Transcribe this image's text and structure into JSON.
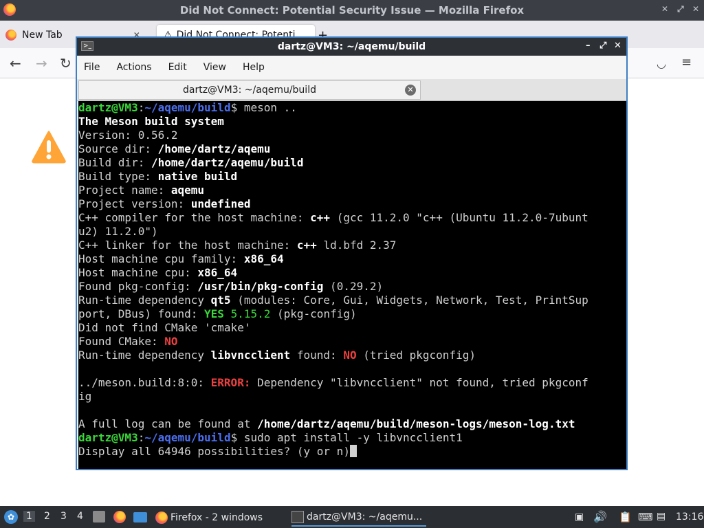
{
  "firefox": {
    "window_title": "Did Not Connect: Potential Security Issue — Mozilla Firefox",
    "tabs": [
      {
        "label": "New Tab"
      },
      {
        "label": "Did Not Connect: Potenti"
      }
    ],
    "new_tab_symbol": "+"
  },
  "terminal": {
    "window_title": "dartz@VM3: ~/aqemu/build",
    "menu": [
      "File",
      "Actions",
      "Edit",
      "View",
      "Help"
    ],
    "tab_label": "dartz@VM3: ~/aqemu/build",
    "lines": [
      [
        {
          "t": "dartz@VM3",
          "c": "g"
        },
        {
          "t": ":",
          "c": ""
        },
        {
          "t": "~/aqemu/build",
          "c": "b"
        },
        {
          "t": "$ meson ..",
          "c": ""
        }
      ],
      [
        {
          "t": "The Meson build system",
          "c": "w"
        }
      ],
      [
        {
          "t": "Version: 0.56.2",
          "c": ""
        }
      ],
      [
        {
          "t": "Source dir: ",
          "c": ""
        },
        {
          "t": "/home/dartz/aqemu",
          "c": "w"
        }
      ],
      [
        {
          "t": "Build dir: ",
          "c": ""
        },
        {
          "t": "/home/dartz/aqemu/build",
          "c": "w"
        }
      ],
      [
        {
          "t": "Build type: ",
          "c": ""
        },
        {
          "t": "native build",
          "c": "w"
        }
      ],
      [
        {
          "t": "Project name: ",
          "c": ""
        },
        {
          "t": "aqemu",
          "c": "w"
        }
      ],
      [
        {
          "t": "Project version: ",
          "c": ""
        },
        {
          "t": "undefined",
          "c": "w"
        }
      ],
      [
        {
          "t": "C++ compiler for the host machine: ",
          "c": ""
        },
        {
          "t": "c++",
          "c": "w"
        },
        {
          "t": " (gcc 11.2.0 \"c++ (Ubuntu 11.2.0-7ubunt",
          "c": ""
        }
      ],
      [
        {
          "t": "u2) 11.2.0\")",
          "c": ""
        }
      ],
      [
        {
          "t": "C++ linker for the host machine: ",
          "c": ""
        },
        {
          "t": "c++",
          "c": "w"
        },
        {
          "t": " ld.bfd 2.37",
          "c": ""
        }
      ],
      [
        {
          "t": "Host machine cpu family: ",
          "c": ""
        },
        {
          "t": "x86_64",
          "c": "w"
        }
      ],
      [
        {
          "t": "Host machine cpu: ",
          "c": ""
        },
        {
          "t": "x86_64",
          "c": "w"
        }
      ],
      [
        {
          "t": "Found pkg-config: ",
          "c": ""
        },
        {
          "t": "/usr/bin/pkg-config",
          "c": "w"
        },
        {
          "t": " (0.29.2)",
          "c": ""
        }
      ],
      [
        {
          "t": "Run-time dependency ",
          "c": ""
        },
        {
          "t": "qt5",
          "c": "w"
        },
        {
          "t": " (modules: Core, Gui, Widgets, Network, Test, PrintSup",
          "c": ""
        }
      ],
      [
        {
          "t": "port, DBus) found: ",
          "c": ""
        },
        {
          "t": "YES",
          "c": "g"
        },
        {
          "t": " ",
          "c": ""
        },
        {
          "t": "5.15.2",
          "c": "gn"
        },
        {
          "t": " (pkg-config)",
          "c": ""
        }
      ],
      [
        {
          "t": "Did not find CMake 'cmake'",
          "c": ""
        }
      ],
      [
        {
          "t": "Found CMake: ",
          "c": ""
        },
        {
          "t": "NO",
          "c": "r"
        }
      ],
      [
        {
          "t": "Run-time dependency ",
          "c": ""
        },
        {
          "t": "libvncclient",
          "c": "w"
        },
        {
          "t": " found: ",
          "c": ""
        },
        {
          "t": "NO",
          "c": "r"
        },
        {
          "t": " (tried pkgconfig)",
          "c": ""
        }
      ],
      [
        {
          "t": "",
          "c": ""
        }
      ],
      [
        {
          "t": "../meson.build:8:0: ",
          "c": ""
        },
        {
          "t": "ERROR:",
          "c": "r"
        },
        {
          "t": " Dependency \"libvncclient\" not found, tried pkgconf",
          "c": ""
        }
      ],
      [
        {
          "t": "ig",
          "c": ""
        }
      ],
      [
        {
          "t": "",
          "c": ""
        }
      ],
      [
        {
          "t": "A full log can be found at ",
          "c": ""
        },
        {
          "t": "/home/dartz/aqemu/build/meson-logs/meson-log.txt",
          "c": "w"
        }
      ],
      [
        {
          "t": "dartz@VM3",
          "c": "g"
        },
        {
          "t": ":",
          "c": ""
        },
        {
          "t": "~/aqemu/build",
          "c": "b"
        },
        {
          "t": "$ sudo apt install -y libvncclient1",
          "c": ""
        }
      ],
      [
        {
          "t": "Display all 64946 possibilities? (y or n)",
          "c": ""
        }
      ]
    ]
  },
  "taskbar": {
    "workspaces": [
      "1",
      "2",
      "3",
      "4"
    ],
    "tasks": [
      {
        "label": "Firefox - 2 windows"
      },
      {
        "label": "dartz@VM3: ~/aqemu..."
      }
    ],
    "clock": "13:16"
  },
  "colors": {
    "terminal_bg": "#000000",
    "prompt_user": "#3ad83a",
    "prompt_path": "#4b6ff0",
    "error": "#ee4040",
    "window_border": "#3c7fc4"
  }
}
